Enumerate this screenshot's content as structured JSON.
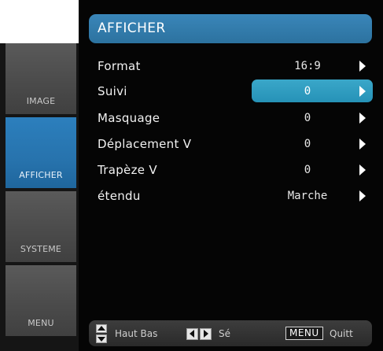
{
  "sidebar": {
    "items": [
      {
        "label": "IMAGE",
        "active": false
      },
      {
        "label": "AFFICHER",
        "active": true
      },
      {
        "label": "SYSTEME",
        "active": false
      },
      {
        "label": "MENU",
        "active": false
      }
    ]
  },
  "header": {
    "title": "AFFICHER"
  },
  "menu": {
    "rows": [
      {
        "label": "Format",
        "value": "16:9"
      },
      {
        "label": "Suivi",
        "value": "0",
        "selected": true
      },
      {
        "label": "Masquage",
        "value": "0"
      },
      {
        "label": "Déplacement V",
        "value": "0"
      },
      {
        "label": "Trapèze V",
        "value": "0"
      },
      {
        "label": "étendu",
        "value": "Marche"
      }
    ]
  },
  "footer": {
    "updown_label": "Haut Bas",
    "leftright_label": "Sé",
    "menu_key": "MENU",
    "quit_label": "Quitt"
  },
  "colors": {
    "accent_blue": "#2c729f",
    "selection_cyan": "#2692b7",
    "active_tab_blue": "#2773ad"
  },
  "icons": [
    "updown-keys-icon",
    "leftright-keys-icon",
    "chevron-right-icon"
  ]
}
